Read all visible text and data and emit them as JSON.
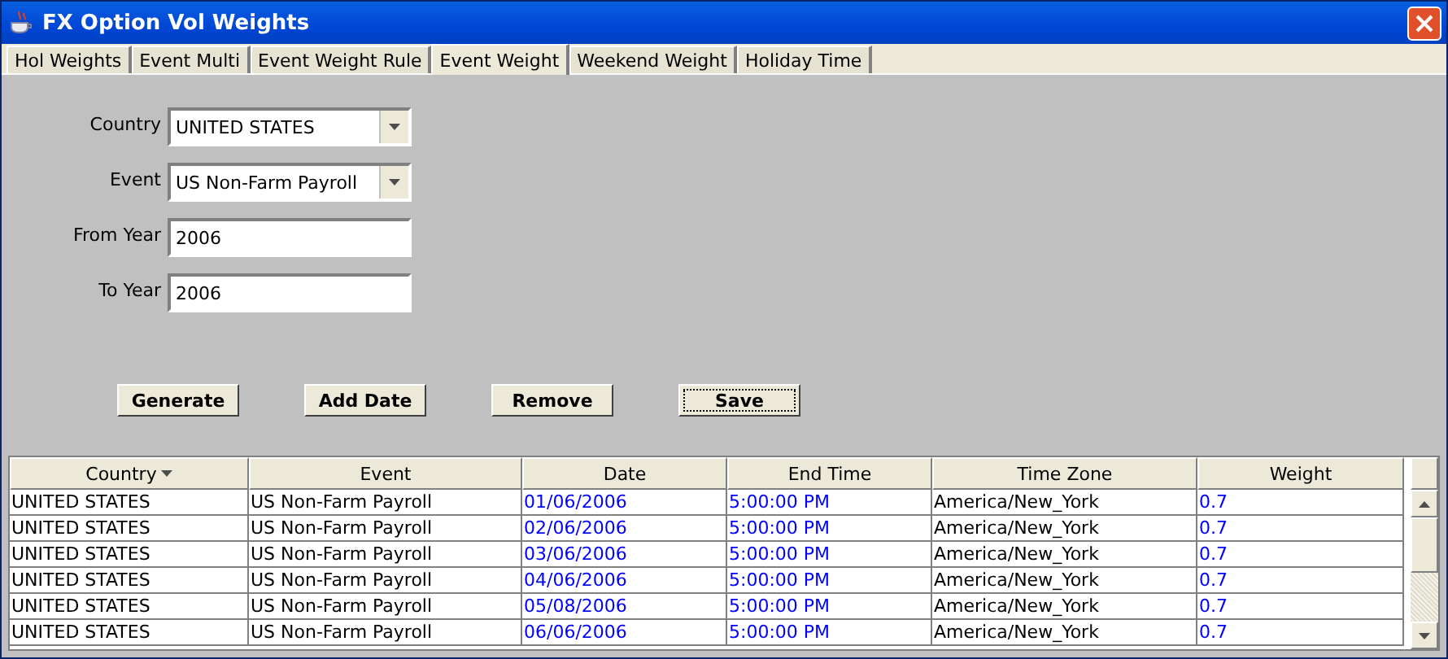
{
  "window": {
    "title": "FX Option Vol Weights"
  },
  "tabs": [
    {
      "label": "Hol Weights",
      "selected": false
    },
    {
      "label": "Event Multi",
      "selected": false
    },
    {
      "label": "Event Weight Rule",
      "selected": false
    },
    {
      "label": "Event Weight",
      "selected": true
    },
    {
      "label": "Weekend Weight",
      "selected": false
    },
    {
      "label": "Holiday Time",
      "selected": false
    }
  ],
  "form": [
    {
      "kind": "dropdown",
      "label": "Country",
      "value": "UNITED STATES"
    },
    {
      "kind": "dropdown",
      "label": "Event",
      "value": "US Non-Farm Payroll"
    },
    {
      "kind": "text",
      "label": "From Year",
      "value": "2006"
    },
    {
      "kind": "text",
      "label": "To Year",
      "value": "2006"
    }
  ],
  "buttons": [
    {
      "label": "Generate",
      "focused": false
    },
    {
      "label": "Add Date",
      "focused": false
    },
    {
      "label": "Remove",
      "focused": false
    },
    {
      "label": "Save",
      "focused": true
    }
  ],
  "table": {
    "columns": [
      {
        "label": "Country",
        "sorted": true,
        "color": "#000000"
      },
      {
        "label": "Event",
        "sorted": false,
        "color": "#000000"
      },
      {
        "label": "Date",
        "sorted": false,
        "color": "#0000ff"
      },
      {
        "label": "End Time",
        "sorted": false,
        "color": "#0000ff"
      },
      {
        "label": "Time Zone",
        "sorted": false,
        "color": "#000000"
      },
      {
        "label": "Weight",
        "sorted": false,
        "color": "#0000ff"
      }
    ],
    "rows": [
      [
        "UNITED STATES",
        "US Non-Farm Payroll",
        "01/06/2006",
        "5:00:00 PM",
        "America/New_York",
        "0.7"
      ],
      [
        "UNITED STATES",
        "US Non-Farm Payroll",
        "02/06/2006",
        "5:00:00 PM",
        "America/New_York",
        "0.7"
      ],
      [
        "UNITED STATES",
        "US Non-Farm Payroll",
        "03/06/2006",
        "5:00:00 PM",
        "America/New_York",
        "0.7"
      ],
      [
        "UNITED STATES",
        "US Non-Farm Payroll",
        "04/06/2006",
        "5:00:00 PM",
        "America/New_York",
        "0.7"
      ],
      [
        "UNITED STATES",
        "US Non-Farm Payroll",
        "05/08/2006",
        "5:00:00 PM",
        "America/New_York",
        "0.7"
      ],
      [
        "UNITED STATES",
        "US Non-Farm Payroll",
        "06/06/2006",
        "5:00:00 PM",
        "America/New_York",
        "0.7"
      ]
    ]
  }
}
